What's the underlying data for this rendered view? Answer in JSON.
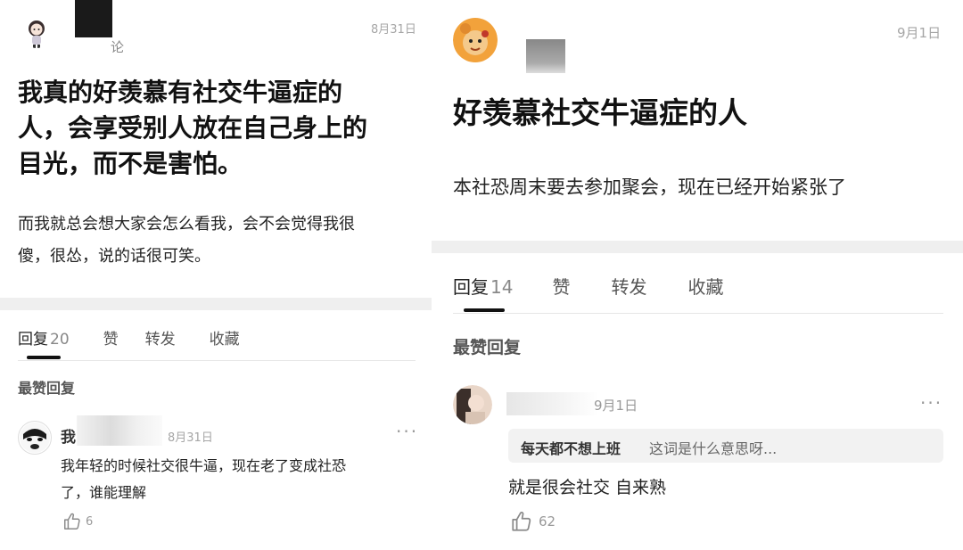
{
  "left": {
    "header": {
      "author_fragment": "论",
      "date": "8月31日"
    },
    "post": {
      "title_lines": [
        "我真的好羡慕有社交牛逼症的",
        "人，会享受别人放在自己身上的",
        "目光，而不是害怕。"
      ],
      "body_lines": [
        "而我就总会想大家会怎么看我，会不会觉得我很",
        "傻，很怂，说的话很可笑。"
      ]
    },
    "tabs": {
      "reply_label": "回复",
      "reply_count": "20",
      "like_label": "赞",
      "share_label": "转发",
      "fav_label": "收藏"
    },
    "section_label": "最赞回复",
    "comment": {
      "name_fragment": "我",
      "date": "8月31日",
      "more": "···",
      "text_lines": [
        "我年轻的时候社交很牛逼，现在老了变成社恐",
        "了，谁能理解"
      ],
      "like_count": "6"
    }
  },
  "right": {
    "header": {
      "date": "9月1日"
    },
    "post": {
      "title": "好羡慕社交牛逼症的人",
      "body": "本社恐周末要去参加聚会，现在已经开始紧张了"
    },
    "tabs": {
      "reply_label": "回复",
      "reply_count": "14",
      "like_label": "赞",
      "share_label": "转发",
      "fav_label": "收藏"
    },
    "section_label": "最赞回复",
    "comment": {
      "date": "9月1日",
      "more": "···",
      "quote_user": "每天都不想上班",
      "quote_text": "这词是什么意思呀...",
      "text": "就是很会社交 自来熟",
      "like_count": "62"
    }
  },
  "colors": {
    "accent": "#111111",
    "muted": "#999999",
    "separator": "#efefef",
    "quote_bg": "#f2f2f2"
  }
}
